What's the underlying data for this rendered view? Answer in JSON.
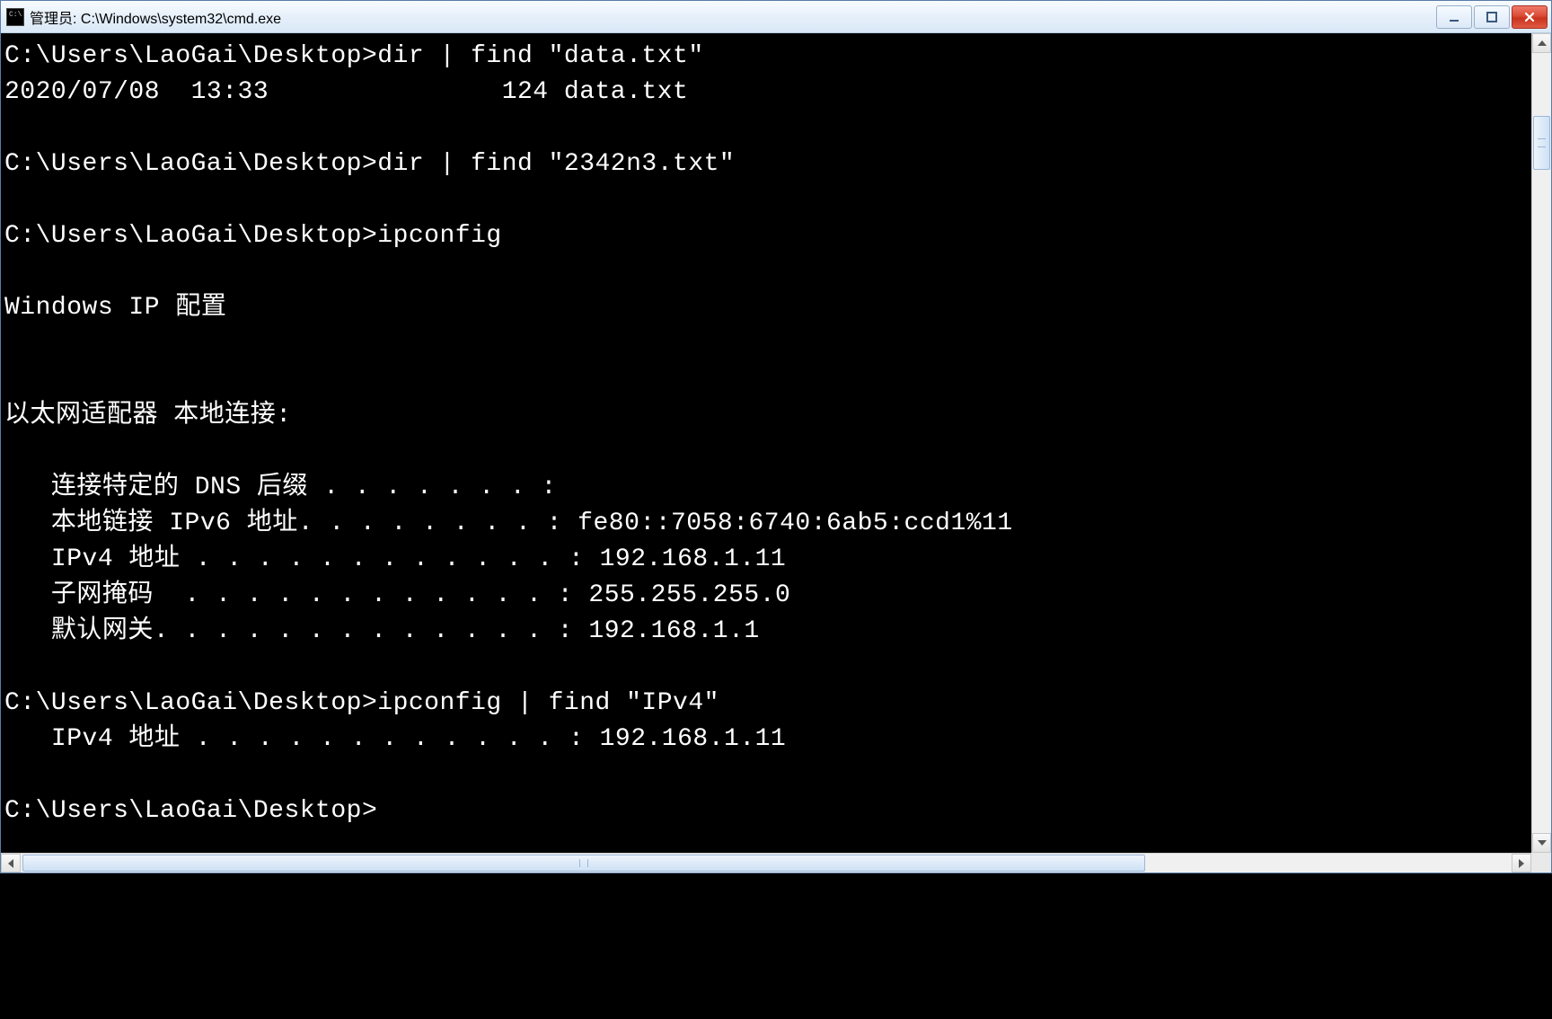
{
  "window": {
    "title": "管理员: C:\\Windows\\system32\\cmd.exe"
  },
  "terminal": {
    "lines": [
      "C:\\Users\\LaoGai\\Desktop>dir | find \"data.txt\"",
      "2020/07/08  13:33               124 data.txt",
      "",
      "C:\\Users\\LaoGai\\Desktop>dir | find \"2342n3.txt\"",
      "",
      "C:\\Users\\LaoGai\\Desktop>ipconfig",
      "",
      "Windows IP 配置",
      "",
      "",
      "以太网适配器 本地连接:",
      "",
      "   连接特定的 DNS 后缀 . . . . . . . :",
      "   本地链接 IPv6 地址. . . . . . . . : fe80::7058:6740:6ab5:ccd1%11",
      "   IPv4 地址 . . . . . . . . . . . . : 192.168.1.11",
      "   子网掩码  . . . . . . . . . . . . : 255.255.255.0",
      "   默认网关. . . . . . . . . . . . . : 192.168.1.1",
      "",
      "C:\\Users\\LaoGai\\Desktop>ipconfig | find \"IPv4\"",
      "   IPv4 地址 . . . . . . . . . . . . : 192.168.1.11",
      "",
      "C:\\Users\\LaoGai\\Desktop>"
    ]
  },
  "commands": {
    "prompt": "C:\\Users\\LaoGai\\Desktop>",
    "history": [
      "dir | find \"data.txt\"",
      "dir | find \"2342n3.txt\"",
      "ipconfig",
      "ipconfig | find \"IPv4\""
    ]
  },
  "ipconfig_result": {
    "header": "Windows IP 配置",
    "adapter": "以太网适配器 本地连接:",
    "dns_suffix": "",
    "ipv6_link_local": "fe80::7058:6740:6ab5:ccd1%11",
    "ipv4": "192.168.1.11",
    "subnet_mask": "255.255.255.0",
    "default_gateway": "192.168.1.1"
  },
  "dir_find_result": {
    "date": "2020/07/08",
    "time": "13:33",
    "size": 124,
    "name": "data.txt"
  }
}
